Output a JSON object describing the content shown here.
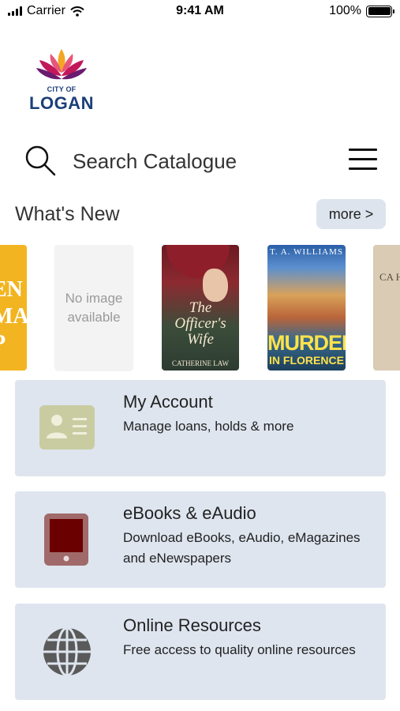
{
  "status_bar": {
    "carrier": "Carrier",
    "time": "9:41 AM",
    "battery": "100%"
  },
  "logo": {
    "city_text": "CITY OF",
    "name_text": "LOGAN",
    "colors": {
      "navy": "#1c3f7a",
      "orange": "#f4a623",
      "magenta": "#c2185b",
      "purple": "#6a1b6f"
    }
  },
  "search": {
    "placeholder": "Search Catalogue",
    "icon": "search-icon",
    "menu_icon": "hamburger-menu-icon"
  },
  "whats_new": {
    "title": "What's New",
    "more_label": "more >",
    "books": [
      {
        "id": "book-1",
        "cover_text": "EN MAR P"
      },
      {
        "id": "book-2",
        "cover_text": "No image available"
      },
      {
        "id": "book-3",
        "title": "The Officer's Wife",
        "author": "CATHERINE LAW"
      },
      {
        "id": "book-4",
        "author": "T. A. WILLIAMS",
        "title_line1": "MURDER",
        "title_line2": "IN FLORENCE"
      },
      {
        "id": "book-5",
        "cover_text": "CA H"
      }
    ]
  },
  "cards": [
    {
      "title": "My Account",
      "description": "Manage loans, holds & more",
      "icon": "id-card-icon",
      "icon_color": "#c9cca1"
    },
    {
      "title": "eBooks & eAudio",
      "description": "Download eBooks, eAudio, eMagazines and eNewspapers",
      "icon": "tablet-icon",
      "icon_color": "#a06a6a"
    },
    {
      "title": "Online Resources",
      "description": "Free access to quality online resources",
      "icon": "globe-icon",
      "icon_color": "#5a5a5a"
    }
  ],
  "colors": {
    "card_bg": "#dee5ef",
    "more_bg": "#dde4ee"
  }
}
